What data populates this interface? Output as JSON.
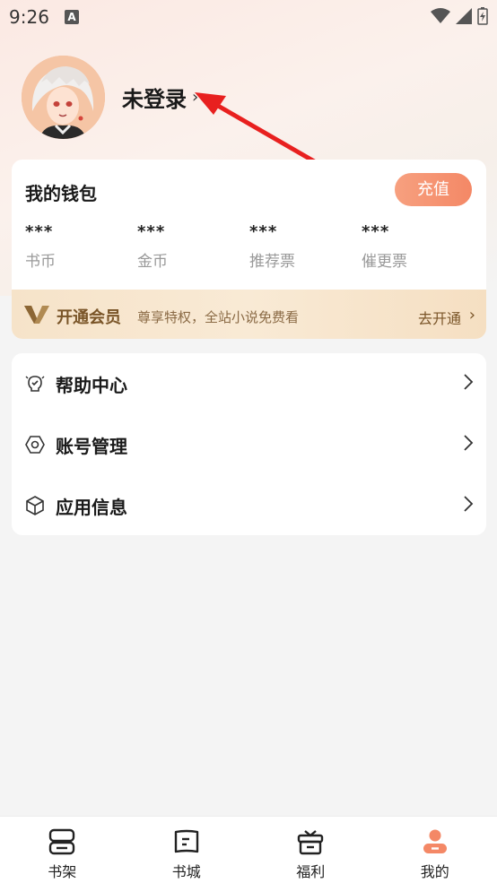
{
  "status_bar": {
    "time": "9:26"
  },
  "profile": {
    "name": "未登录",
    "chevron": "›"
  },
  "wallet": {
    "title": "我的钱包",
    "recharge_label": "充值",
    "stats": [
      {
        "value": "***",
        "label": "书币"
      },
      {
        "value": "***",
        "label": "金币"
      },
      {
        "value": "***",
        "label": "推荐票"
      },
      {
        "value": "***",
        "label": "催更票"
      }
    ]
  },
  "vip": {
    "title": "开通会员",
    "description": "尊享特权，全站小说免费看",
    "link_label": "去开通",
    "chevron": "›"
  },
  "menu": [
    {
      "label": "帮助中心",
      "icon": "help-bulb-icon"
    },
    {
      "label": "账号管理",
      "icon": "hexagon-nut-icon"
    },
    {
      "label": "应用信息",
      "icon": "cube-icon"
    }
  ],
  "tabs": [
    {
      "label": "书架",
      "icon": "bookshelf-icon"
    },
    {
      "label": "书城",
      "icon": "book-open-icon"
    },
    {
      "label": "福利",
      "icon": "gift-icon"
    },
    {
      "label": "我的",
      "icon": "person-icon",
      "active": true
    }
  ],
  "colors": {
    "accent": "#f48866",
    "vip_text": "#7a5528",
    "annotation_arrow": "#e8201f"
  }
}
